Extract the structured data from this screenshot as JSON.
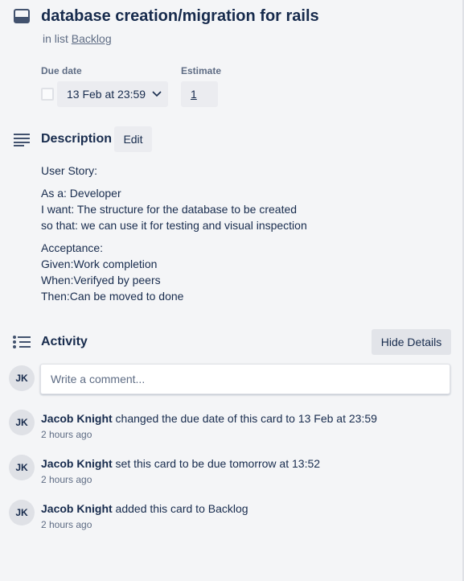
{
  "card": {
    "title": "database creation/migration for rails",
    "in_list_prefix": "in list",
    "list_name": "Backlog"
  },
  "fields": {
    "due_date_label": "Due date",
    "due_date_value": "13 Feb at 23:59",
    "estimate_label": "Estimate",
    "estimate_value": "1"
  },
  "description": {
    "heading": "Description",
    "edit_label": "Edit",
    "paragraphs": [
      [
        "User Story:"
      ],
      [
        "As a: Developer",
        "I want: The structure for the database to be created",
        "so that: we can use it for testing and visual inspection"
      ],
      [
        "Acceptance:",
        "Given:Work completion",
        "When:Verifyed by peers",
        "Then:Can be moved to done"
      ]
    ]
  },
  "activity": {
    "heading": "Activity",
    "hide_details_label": "Hide Details",
    "comment_placeholder": "Write a comment...",
    "user_initials": "JK",
    "entries": [
      {
        "initials": "JK",
        "user": "Jacob Knight",
        "action": " changed the due date of this card to 13 Feb at 23:59",
        "time": "2 hours ago"
      },
      {
        "initials": "JK",
        "user": "Jacob Knight",
        "action": " set this card to be due tomorrow at 13:52",
        "time": "2 hours ago"
      },
      {
        "initials": "JK",
        "user": "Jacob Knight",
        "action": " added this card to Backlog",
        "time": "2 hours ago"
      }
    ]
  },
  "icons": {
    "title": "card-icon",
    "description": "description-lines-icon",
    "activity": "activity-list-icon",
    "due_dropdown": "chevron-down-icon"
  },
  "colors": {
    "background": "#f4f5f7",
    "text": "#172b4d",
    "muted": "#5e6c84",
    "button": "#ebecf0"
  }
}
